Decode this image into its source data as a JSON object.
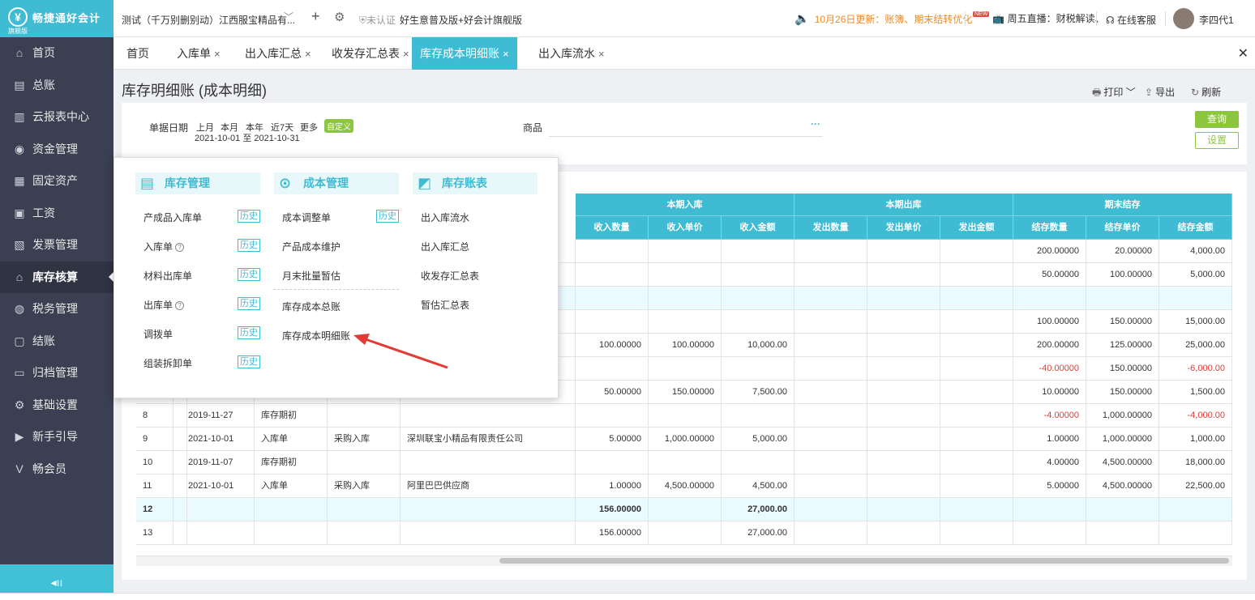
{
  "app": {
    "name": "畅捷通好会计",
    "edition_tag": "旗舰版"
  },
  "topbar": {
    "company": "测试（千万别删别动）江西服宝精品有...",
    "unverified": "未认证",
    "edition": "好生意普及版+好会计旗舰版",
    "notice": "10月26日更新：账簿、期末结转优化",
    "live_badge": "NEW",
    "live": "周五直播：财税解读、",
    "service": "在线客服",
    "user": "李四代1"
  },
  "sidebar": {
    "items": [
      {
        "label": "首页",
        "icon": "home-icon"
      },
      {
        "label": "总账",
        "icon": "ledger-icon"
      },
      {
        "label": "云报表中心",
        "icon": "chart-icon"
      },
      {
        "label": "资金管理",
        "icon": "money-icon"
      },
      {
        "label": "固定资产",
        "icon": "building-icon"
      },
      {
        "label": "工资",
        "icon": "salary-icon"
      },
      {
        "label": "发票管理",
        "icon": "invoice-icon"
      },
      {
        "label": "库存核算",
        "icon": "warehouse-icon"
      },
      {
        "label": "税务管理",
        "icon": "tax-icon"
      },
      {
        "label": "结账",
        "icon": "close-book-icon"
      },
      {
        "label": "归档管理",
        "icon": "archive-icon"
      },
      {
        "label": "基础设置",
        "icon": "settings-icon"
      },
      {
        "label": "新手引导",
        "icon": "guide-icon"
      },
      {
        "label": "畅会员",
        "icon": "vip-icon"
      }
    ],
    "active_index": 7,
    "collapse_icon": "collapse-icon"
  },
  "tabs": [
    {
      "label": "首页",
      "closable": false
    },
    {
      "label": "入库单",
      "closable": true
    },
    {
      "label": "出入库汇总",
      "closable": true
    },
    {
      "label": "收发存汇总表",
      "closable": true
    },
    {
      "label": "库存成本明细账",
      "closable": true,
      "active": true
    },
    {
      "label": "出入库流水",
      "closable": true
    }
  ],
  "page": {
    "title": "库存明细账 (成本明细)",
    "actions": {
      "print": "打印",
      "export": "导出",
      "refresh": "刷新"
    }
  },
  "filter": {
    "date_label": "单据日期",
    "periods": [
      "上月",
      "本月",
      "本年",
      "近7天",
      "更多"
    ],
    "custom": "自定义",
    "date_from": "2021-10-01",
    "date_sep": "至",
    "date_to": "2021-10-31",
    "goods_label": "商品",
    "goods_value": "",
    "query": "查询",
    "settings": "设置"
  },
  "table": {
    "group_headers": [
      "本期入库",
      "本期出库",
      "期末结存"
    ],
    "columns": [
      "收入数量",
      "收入单价",
      "收入金额",
      "发出数量",
      "发出单价",
      "发出金额",
      "结存数量",
      "结存单价",
      "结存金额"
    ],
    "rows": [
      {
        "no": "",
        "date": "",
        "type": "",
        "biz": "",
        "partner": "",
        "in_qty": "",
        "in_price": "",
        "in_amt": "",
        "out_qty": "",
        "out_price": "",
        "out_amt": "",
        "bal_qty": "200.00000",
        "bal_price": "20.00000",
        "bal_amt": "4,000.00"
      },
      {
        "no": "",
        "date": "",
        "type": "",
        "biz": "",
        "partner": "",
        "in_qty": "",
        "in_price": "",
        "in_amt": "",
        "out_qty": "",
        "out_price": "",
        "out_amt": "",
        "bal_qty": "50.00000",
        "bal_price": "100.00000",
        "bal_amt": "5,000.00"
      },
      {
        "no": "",
        "date": "",
        "type": "",
        "biz": "",
        "partner": "",
        "in_qty": "",
        "in_price": "",
        "in_amt": "",
        "out_qty": "",
        "out_price": "",
        "out_amt": "",
        "bal_qty": "",
        "bal_price": "",
        "bal_amt": "",
        "highlight": true
      },
      {
        "no": "",
        "date": "",
        "type": "",
        "biz": "",
        "partner": "",
        "in_qty": "",
        "in_price": "",
        "in_amt": "",
        "out_qty": "",
        "out_price": "",
        "out_amt": "",
        "bal_qty": "100.00000",
        "bal_price": "150.00000",
        "bal_amt": "15,000.00"
      },
      {
        "no": "",
        "date": "",
        "type": "",
        "biz": "",
        "partner": "",
        "in_qty": "100.00000",
        "in_price": "100.00000",
        "in_amt": "10,000.00",
        "out_qty": "",
        "out_price": "",
        "out_amt": "",
        "bal_qty": "200.00000",
        "bal_price": "125.00000",
        "bal_amt": "25,000.00"
      },
      {
        "no": "",
        "date": "",
        "type": "",
        "biz": "",
        "partner": "",
        "in_qty": "",
        "in_price": "",
        "in_amt": "",
        "out_qty": "",
        "out_price": "",
        "out_amt": "",
        "bal_qty": "-40.00000",
        "bal_price": "150.00000",
        "bal_amt": "-6,000.00",
        "negative": true
      },
      {
        "no": "",
        "date": "",
        "type": "",
        "biz": "",
        "partner": "",
        "in_qty": "50.00000",
        "in_price": "150.00000",
        "in_amt": "7,500.00",
        "out_qty": "",
        "out_price": "",
        "out_amt": "",
        "bal_qty": "10.00000",
        "bal_price": "150.00000",
        "bal_amt": "1,500.00"
      },
      {
        "no": "8",
        "date": "2019-11-27",
        "type": "库存期初",
        "biz": "",
        "partner": "",
        "in_qty": "",
        "in_price": "",
        "in_amt": "",
        "out_qty": "",
        "out_price": "",
        "out_amt": "",
        "bal_qty": "-4.00000",
        "bal_price": "1,000.00000",
        "bal_amt": "-4,000.00",
        "negative": true
      },
      {
        "no": "9",
        "date": "2021-10-01",
        "type": "入库单",
        "biz": "采购入库",
        "partner": "深圳联宝小精品有限责任公司",
        "in_qty": "5.00000",
        "in_price": "1,000.00000",
        "in_amt": "5,000.00",
        "out_qty": "",
        "out_price": "",
        "out_amt": "",
        "bal_qty": "1.00000",
        "bal_price": "1,000.00000",
        "bal_amt": "1,000.00"
      },
      {
        "no": "10",
        "date": "2019-11-07",
        "type": "库存期初",
        "biz": "",
        "partner": "",
        "in_qty": "",
        "in_price": "",
        "in_amt": "",
        "out_qty": "",
        "out_price": "",
        "out_amt": "",
        "bal_qty": "4.00000",
        "bal_price": "4,500.00000",
        "bal_amt": "18,000.00"
      },
      {
        "no": "11",
        "date": "2021-10-01",
        "type": "入库单",
        "biz": "采购入库",
        "partner": "阿里巴巴供应商",
        "in_qty": "1.00000",
        "in_price": "4,500.00000",
        "in_amt": "4,500.00",
        "out_qty": "",
        "out_price": "",
        "out_amt": "",
        "bal_qty": "5.00000",
        "bal_price": "4,500.00000",
        "bal_amt": "22,500.00"
      },
      {
        "no": "12",
        "date": "",
        "type": "",
        "biz": "",
        "partner": "",
        "in_qty": "156.00000",
        "in_price": "",
        "in_amt": "27,000.00",
        "out_qty": "",
        "out_price": "",
        "out_amt": "",
        "bal_qty": "",
        "bal_price": "",
        "bal_amt": "",
        "highlight": true,
        "bold": true
      },
      {
        "no": "13",
        "date": "",
        "type": "",
        "biz": "",
        "partner": "",
        "in_qty": "156.00000",
        "in_price": "",
        "in_amt": "27,000.00",
        "out_qty": "",
        "out_price": "",
        "out_amt": "",
        "bal_qty": "",
        "bal_price": "",
        "bal_amt": ""
      }
    ]
  },
  "popup": {
    "columns": [
      {
        "title": "库存管理",
        "icon": "stack-icon",
        "items": [
          {
            "label": "产成品入库单",
            "history": "历史"
          },
          {
            "label": "入库单",
            "help": "?",
            "history": "历史"
          },
          {
            "label": "材料出库单",
            "history": "历史"
          },
          {
            "label": "出库单",
            "help": "?",
            "history": "历史"
          },
          {
            "label": "调拨单",
            "history": "历史"
          },
          {
            "label": "组装拆卸单",
            "history": "历史"
          }
        ]
      },
      {
        "title": "成本管理",
        "icon": "cost-icon",
        "items": [
          {
            "label": "成本调整单",
            "history": "历史"
          },
          {
            "label": "产品成本维护"
          },
          {
            "label": "月末批量暂估"
          },
          {
            "label": "库存成本总账"
          },
          {
            "label": "库存成本明细账"
          }
        ]
      },
      {
        "title": "库存账表",
        "icon": "report-icon",
        "items": [
          {
            "label": "出入库流水"
          },
          {
            "label": "出入库汇总"
          },
          {
            "label": "收发存汇总表"
          },
          {
            "label": "暂估汇总表"
          }
        ]
      }
    ]
  },
  "colors": {
    "accent": "#3fbbd4",
    "sidebar": "#3a3f51",
    "green": "#8cc63f",
    "notice": "#f08a24",
    "negative": "#e53935",
    "arrow": "#e53935"
  }
}
